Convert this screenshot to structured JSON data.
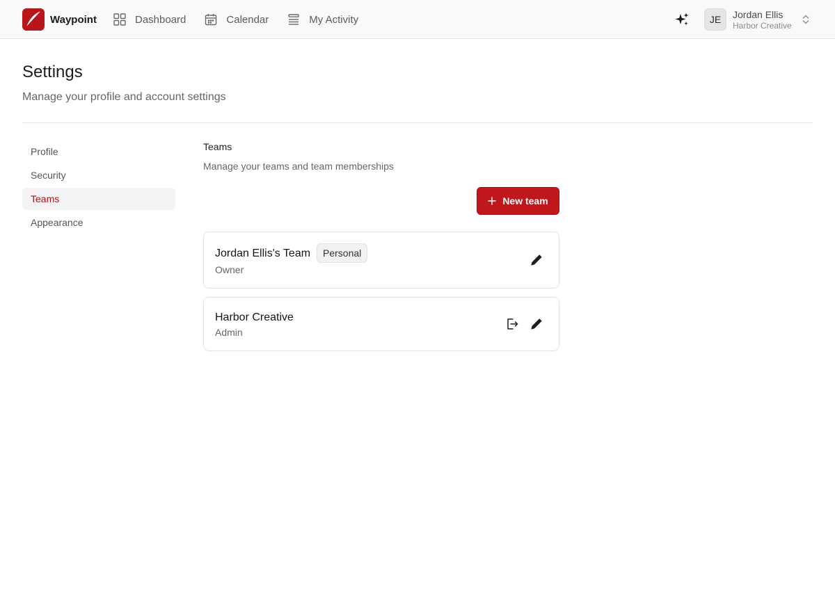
{
  "app": {
    "name": "Waypoint",
    "logo_icon": "quill-icon",
    "accent_color": "#c0171d"
  },
  "nav": {
    "items": [
      {
        "label": "Dashboard",
        "icon": "grid-icon"
      },
      {
        "label": "Calendar",
        "icon": "calendar-icon"
      },
      {
        "label": "My Activity",
        "icon": "list-icon"
      }
    ]
  },
  "account": {
    "initials": "JE",
    "name": "Jordan Ellis",
    "org": "Harbor Creative",
    "ai_icon": "sparkles-icon"
  },
  "header": {
    "title": "Settings",
    "subtitle": "Manage your profile and account settings"
  },
  "side_menu": {
    "items": [
      {
        "label": "Profile",
        "active": false
      },
      {
        "label": "Security",
        "active": false
      },
      {
        "label": "Teams",
        "active": true
      },
      {
        "label": "Appearance",
        "active": false
      }
    ]
  },
  "teams": {
    "title": "Teams",
    "subtitle": "Manage your teams and team memberships",
    "new_team_label": "New team",
    "list": [
      {
        "name": "Jordan Ellis's Team",
        "badge": "Personal",
        "role": "Owner"
      },
      {
        "name": "Harbor Creative",
        "role": "Admin"
      }
    ]
  }
}
